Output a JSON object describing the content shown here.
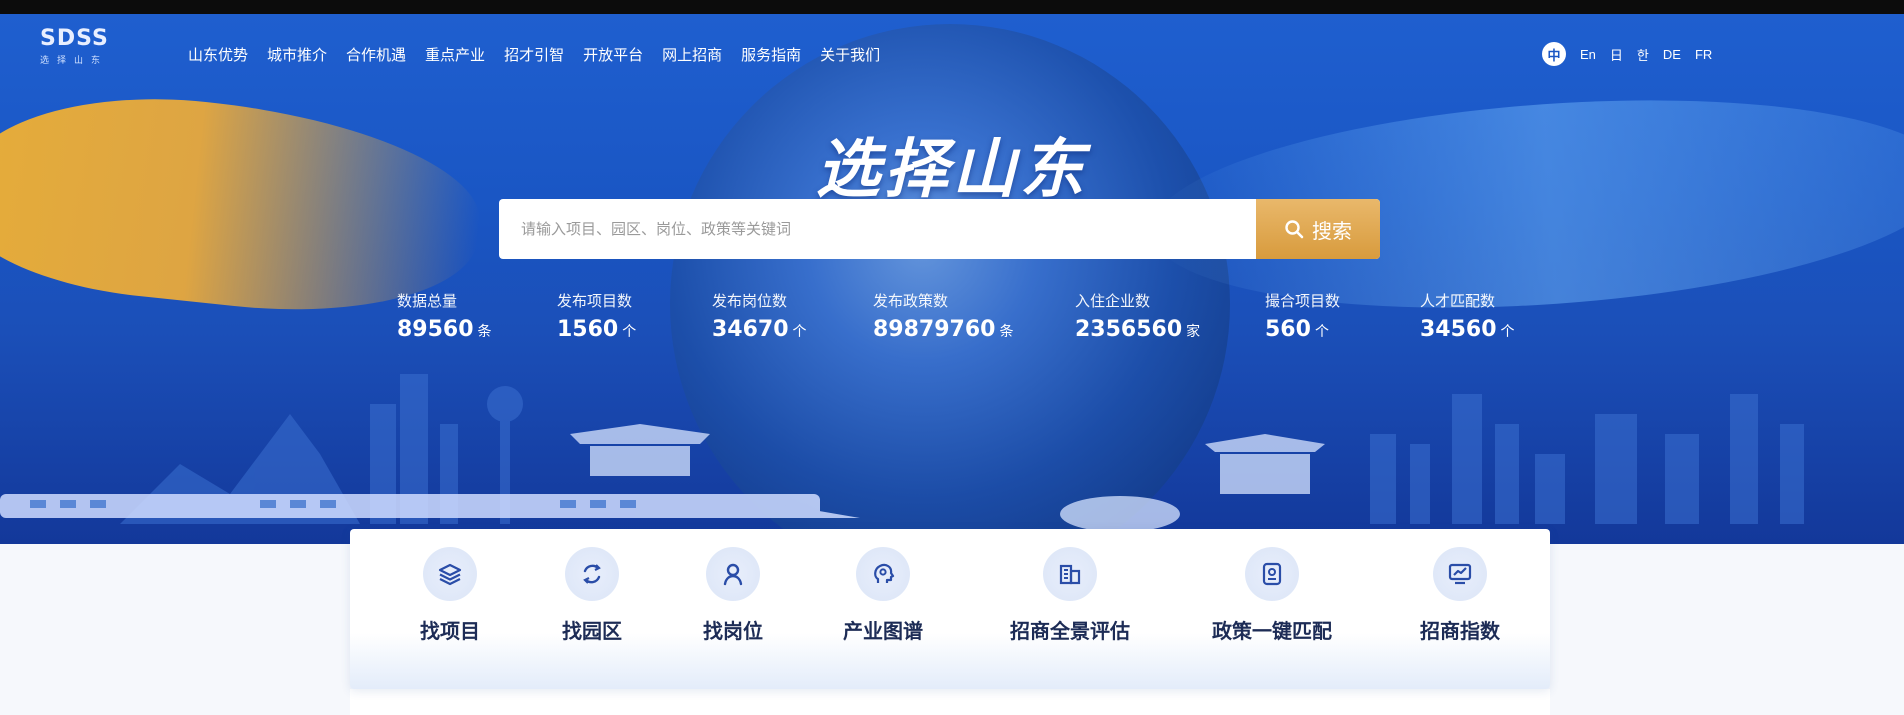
{
  "nav": {
    "logo_mark": "SDSS",
    "logo_sub": "选择山东",
    "items": [
      "山东优势",
      "城市推介",
      "合作机遇",
      "重点产业",
      "招才引智",
      "开放平台",
      "网上招商",
      "服务指南",
      "关于我们"
    ],
    "languages": [
      "中",
      "En",
      "日",
      "한",
      "DE",
      "FR"
    ]
  },
  "hero": {
    "title": "选择山东"
  },
  "search": {
    "placeholder": "请输入项目、园区、岗位、政策等关键词",
    "button_label": "搜索",
    "icon": "search-icon"
  },
  "stats": [
    {
      "label": "数据总量",
      "value": "89560",
      "unit": "条"
    },
    {
      "label": "发布项目数",
      "value": "1560",
      "unit": "个"
    },
    {
      "label": "发布岗位数",
      "value": "34670",
      "unit": "个"
    },
    {
      "label": "发布政策数",
      "value": "89879760",
      "unit": "条"
    },
    {
      "label": "入住企业数",
      "value": "2356560",
      "unit": "家"
    },
    {
      "label": "撮合项目数",
      "value": "560",
      "unit": "个"
    },
    {
      "label": "人才匹配数",
      "value": "34560",
      "unit": "个"
    }
  ],
  "tools": [
    {
      "label": "找项目",
      "icon": "layers-icon"
    },
    {
      "label": "找园区",
      "icon": "refresh-cycle-icon"
    },
    {
      "label": "找岗位",
      "icon": "person-icon"
    },
    {
      "label": "产业图谱",
      "icon": "head-gear-icon"
    },
    {
      "label": "招商全景评估",
      "icon": "building-icon"
    },
    {
      "label": "政策一键匹配",
      "icon": "id-badge-icon"
    },
    {
      "label": "招商指数",
      "icon": "chart-monitor-icon"
    }
  ],
  "colors": {
    "hero_blue": "#1b56c4",
    "gold": "#d89b3d",
    "tool_text": "#1d2c56",
    "icon_color": "#2a4da8"
  }
}
